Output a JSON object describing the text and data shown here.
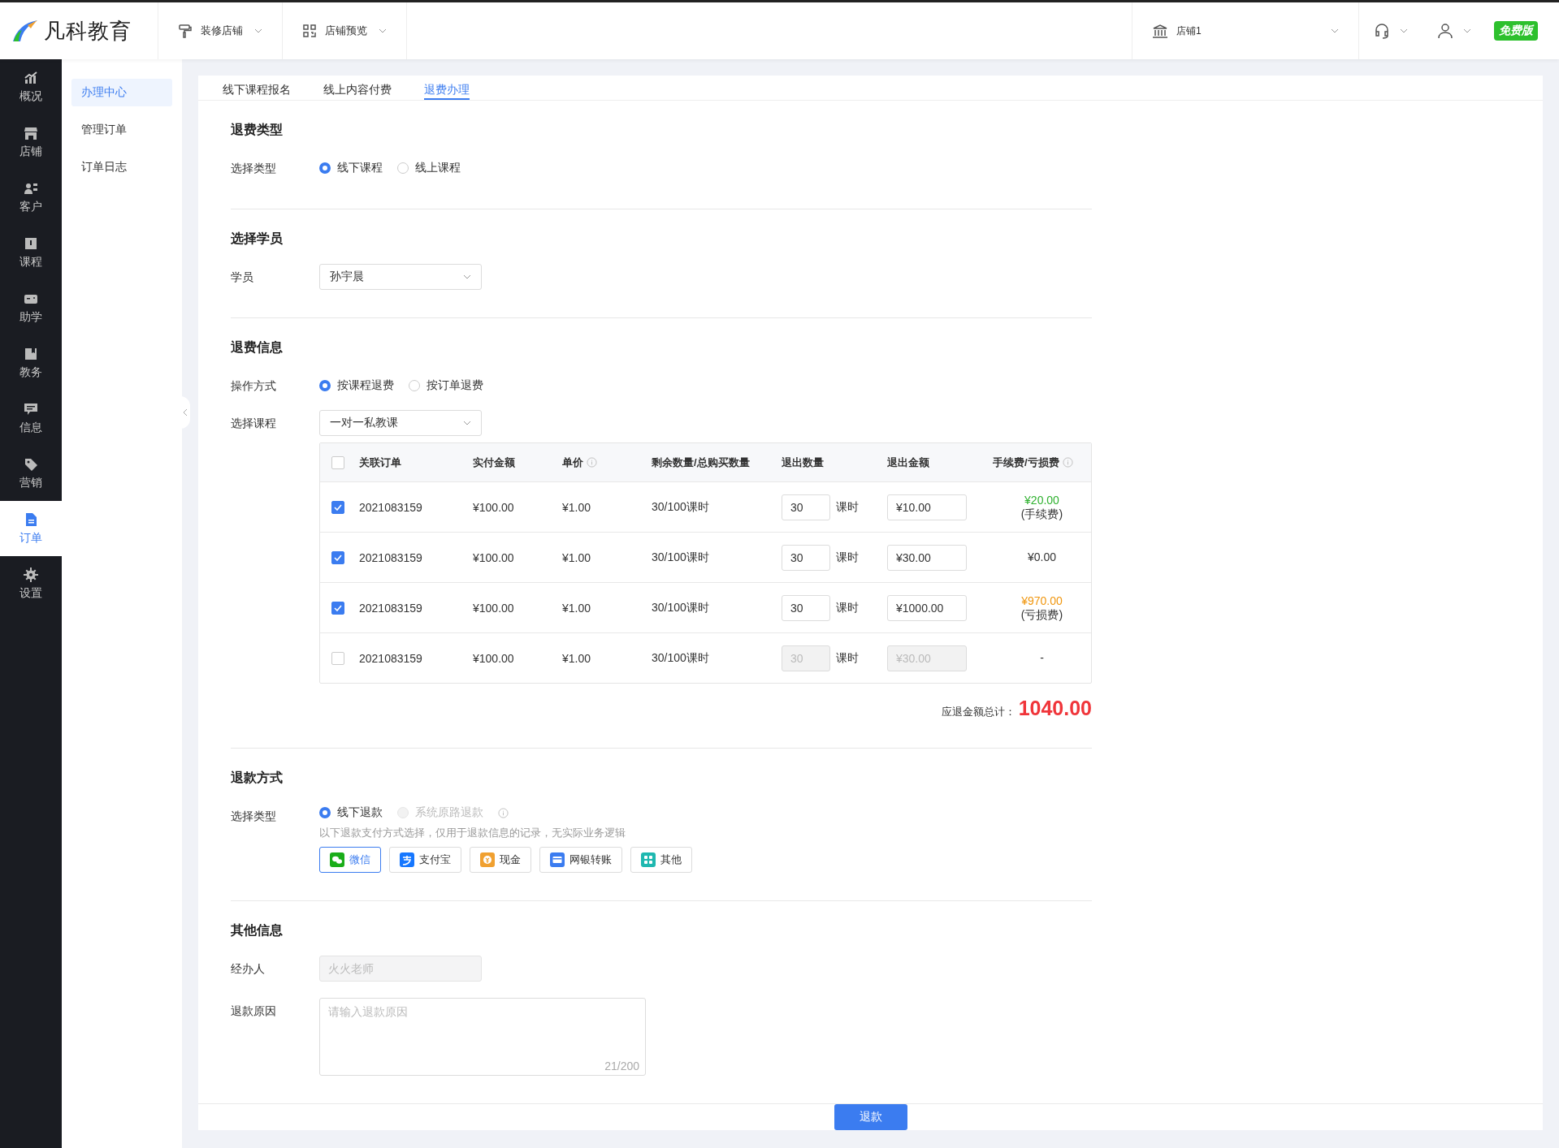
{
  "header": {
    "logo_text": "凡科教育",
    "menus": [
      {
        "label": "装修店铺",
        "kind": "brush"
      },
      {
        "label": "店铺预览",
        "kind": "grid"
      }
    ],
    "store": "店铺1",
    "badge": "免费版"
  },
  "nav": [
    {
      "label": "概况",
      "kind": "chart",
      "selected": false
    },
    {
      "label": "店铺",
      "kind": "shop",
      "selected": false
    },
    {
      "label": "客户",
      "kind": "users",
      "selected": false
    },
    {
      "label": "课程",
      "kind": "book",
      "selected": false
    },
    {
      "label": "助学",
      "kind": "gamepad",
      "selected": false
    },
    {
      "label": "教务",
      "kind": "bookmark",
      "selected": false
    },
    {
      "label": "信息",
      "kind": "message",
      "selected": false
    },
    {
      "label": "营销",
      "kind": "tag",
      "selected": false
    },
    {
      "label": "订单",
      "kind": "doc",
      "selected": true
    },
    {
      "label": "设置",
      "kind": "gear",
      "selected": false
    }
  ],
  "subnav": [
    {
      "label": "办理中心",
      "selected": true
    },
    {
      "label": "管理订单",
      "selected": false
    },
    {
      "label": "订单日志",
      "selected": false
    }
  ],
  "tabs": [
    {
      "label": "线下课程报名",
      "selected": false
    },
    {
      "label": "线上内容付费",
      "selected": false
    },
    {
      "label": "退费办理",
      "selected": true
    }
  ],
  "refund_type": {
    "title": "退费类型",
    "label": "选择类型",
    "options": [
      {
        "label": "线下课程",
        "selected": true
      },
      {
        "label": "线上课程",
        "selected": false
      }
    ]
  },
  "student": {
    "title": "选择学员",
    "label": "学员",
    "value": "孙宇晨"
  },
  "refund_info": {
    "title": "退费信息",
    "method_label": "操作方式",
    "methods": [
      {
        "label": "按课程退费",
        "selected": true
      },
      {
        "label": "按订单退费",
        "selected": false
      }
    ],
    "course_label": "选择课程",
    "course": "一对一私教课",
    "table": {
      "columns": [
        "关联订单",
        "实付金额",
        "单价",
        "剩余数量/总购买数量",
        "退出数量",
        "退出金额",
        "手续费/亏损费"
      ],
      "all_checked": false,
      "rows": [
        {
          "checked": true,
          "order": "2021083159",
          "paid": "¥100.00",
          "price": "¥1.00",
          "remaining": "30/100课时",
          "qty": "30",
          "unit": "课时",
          "amount": "¥10.00",
          "disabled": false,
          "fee": "¥20.00",
          "fee_note": "(手续费)",
          "color": "#2fb12f"
        },
        {
          "checked": true,
          "order": "2021083159",
          "paid": "¥100.00",
          "price": "¥1.00",
          "remaining": "30/100课时",
          "qty": "30",
          "unit": "课时",
          "amount": "¥30.00",
          "disabled": false,
          "fee": "¥0.00",
          "color": "#333333"
        },
        {
          "checked": true,
          "order": "2021083159",
          "paid": "¥100.00",
          "price": "¥1.00",
          "remaining": "30/100课时",
          "qty": "30",
          "unit": "课时",
          "amount": "¥1000.00",
          "disabled": false,
          "fee": "¥970.00",
          "fee_note": "(亏损费)",
          "color": "#f0960e"
        },
        {
          "checked": false,
          "order": "2021083159",
          "paid": "¥100.00",
          "price": "¥1.00",
          "remaining": "30/100课时",
          "qty": "30",
          "unit": "课时",
          "amount": "¥30.00",
          "disabled": true,
          "fee": "-",
          "color": "#333333"
        }
      ]
    },
    "total_label": "应退金额总计：",
    "total": "1040.00"
  },
  "refund_method": {
    "title": "退款方式",
    "label": "选择类型",
    "options": [
      {
        "label": "线下退款",
        "selected": true,
        "disabled": false
      },
      {
        "label": "系统原路退款",
        "selected": false,
        "disabled": true
      }
    ],
    "note": "以下退款支付方式选择，仅用于退款信息的记录，无实际业务逻辑",
    "payments": [
      {
        "label": "微信",
        "kind": "wechat",
        "selected": true
      },
      {
        "label": "支付宝",
        "kind": "alipay",
        "selected": false
      },
      {
        "label": "现金",
        "kind": "cash",
        "selected": false
      },
      {
        "label": "网银转账",
        "kind": "bank",
        "selected": false
      },
      {
        "label": "其他",
        "kind": "other",
        "selected": false
      }
    ]
  },
  "other": {
    "title": "其他信息",
    "handler_label": "经办人",
    "handler_placeholder": "火火老师",
    "reason_label": "退款原因",
    "reason_placeholder": "请输入退款原因",
    "counter": "21/200"
  },
  "submit": "退款"
}
